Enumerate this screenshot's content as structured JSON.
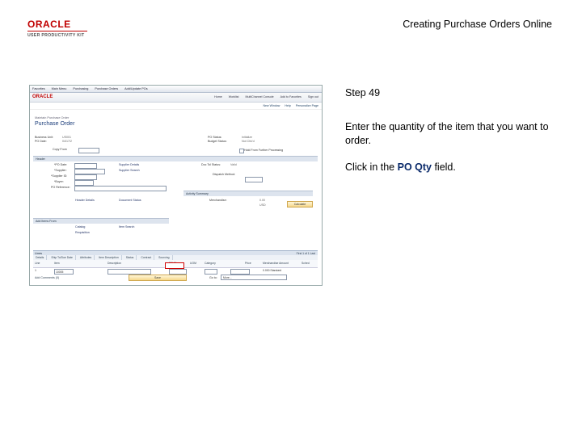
{
  "header": {
    "logo_top": "ORACLE",
    "logo_bottom": "USER PRODUCTIVITY KIT",
    "title": "Creating Purchase Orders Online"
  },
  "step": {
    "label": "Step 49",
    "instruction": "Enter the quantity of the item that you want to order.",
    "action_prefix": "Click in the ",
    "action_field": "PO Qty",
    "action_suffix": " field."
  },
  "screenshot": {
    "menubar": [
      "Favorites",
      "Main Menu",
      "Purchasing",
      "Purchase Orders",
      "Add/Update POs"
    ],
    "brand": "ORACLE",
    "toplinks": [
      "Home",
      "Worklist",
      "MultiChannel Console",
      "Add to Favorites",
      "Sign out"
    ],
    "toolbar": [
      "New Window",
      "Help",
      "Personalize Page"
    ],
    "breadcrumb": "Maintain Purchase Order",
    "page_title": "Purchase Order",
    "fields": {
      "business_unit_label": "Business Unit:",
      "business_unit_value": "US001",
      "po_date_label": "PO Date:",
      "po_date_value": "04/17/2",
      "po_status_label": "PO Status:",
      "po_status_value": "Initialize",
      "budget_status_label": "Budget Status:",
      "budget_status_value": "Not Chk'd",
      "hold_label": "Hold From Further Processing",
      "copy_from_label": "Copy From",
      "header_label": "Header",
      "po_date2_label": "*PO Date:",
      "supplier_label": "*Supplier:",
      "supplier_id_label": "*Supplier ID:",
      "buyer_label": "*Buyer:",
      "po_reference_label": "PO Reference:",
      "supplier_details": "Supplier Details",
      "supplier_search": "Supplier Search",
      "header_details": "Header Details",
      "activity_summary": "Activity Summary",
      "document_status": "Document Status",
      "dispatch_method_label": "Dispatch Method:",
      "dispatch_method_value": "Print",
      "doc_tol_status_label": "Doc Tol Status:",
      "doc_tol_status_value": "Valid",
      "merch_amount_label": "Merchandise:",
      "merch_amount_value": "0.00",
      "currency_value": "USD",
      "calculate_button": "Calculate",
      "add_items_from": "Add Items From",
      "catalog": "Catalog",
      "item_search": "Item Search",
      "requisition": "Requisition"
    },
    "lines": {
      "title": "Lines",
      "pager": "First  1 of 1  Last",
      "tabs": [
        "Details",
        "Ship To/Due Date",
        "Attributes",
        "Item Description",
        "Status",
        "Contract",
        "Sourcing"
      ],
      "columns": [
        "Line",
        "Item",
        "Description",
        "PO Qty",
        "UOM",
        "Category",
        "Price",
        "Merchandise Amount",
        "Sched"
      ],
      "row": {
        "line": "1",
        "item": "10005",
        "merch": "0.000 Standard"
      }
    },
    "footer_left": "Add Comments (0)",
    "save_button": "Save",
    "footer_go": "Go to:",
    "footer_go_value": "More..."
  }
}
